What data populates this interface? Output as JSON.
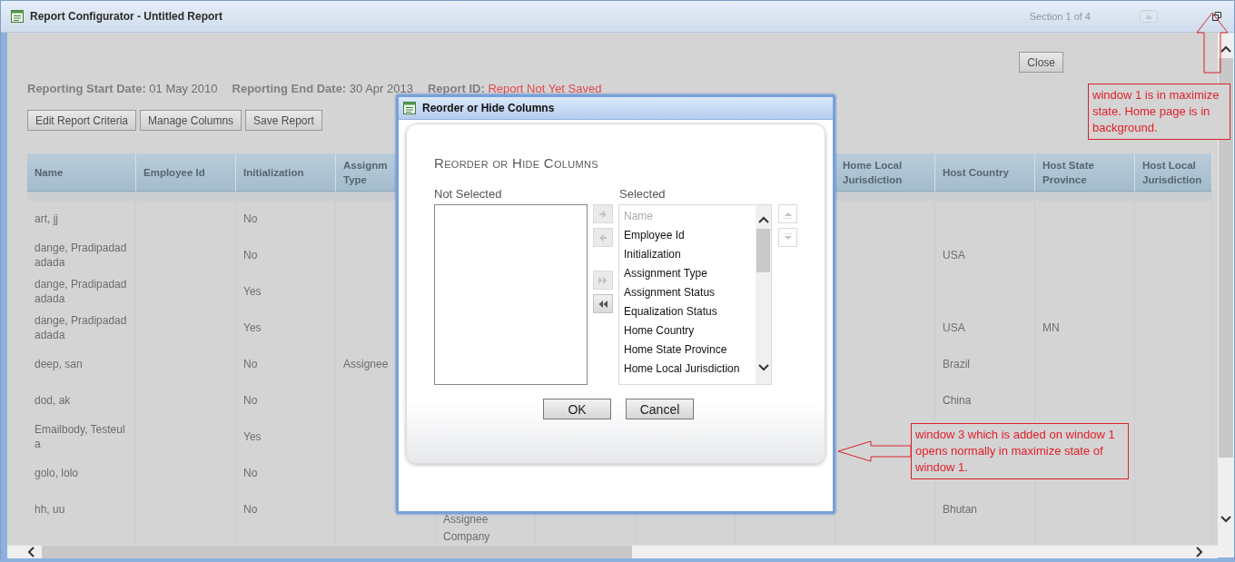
{
  "window": {
    "title": "Report Configurator - Untitled Report",
    "section_label": "Section 1 of 4"
  },
  "close_button": "Close",
  "report_info": [
    {
      "label": "Reporting Start Date:",
      "value": "01 May 2010",
      "kind": "plain"
    },
    {
      "label": "Reporting End Date:",
      "value": "30 Apr 2013",
      "kind": "plain"
    },
    {
      "label": "Report ID:",
      "value": "Report Not Yet Saved",
      "kind": "alert"
    }
  ],
  "toolbar": [
    "Edit Report Criteria",
    "Manage Columns",
    "Save Report"
  ],
  "table": {
    "columns": [
      "Name",
      "Employee Id",
      "Initialization",
      "Assignm Type",
      null,
      null,
      null,
      null,
      "Home Local Jurisdiction",
      "Host Country",
      "Host State Province",
      "Host Local Jurisdiction"
    ],
    "rows": [
      [
        "art, jj",
        null,
        "No",
        null,
        null,
        null,
        null,
        null,
        null,
        null,
        null,
        null
      ],
      [
        "dange, Pradipadadadada",
        null,
        "No",
        null,
        null,
        null,
        null,
        null,
        null,
        "USA",
        null,
        null
      ],
      [
        "dange, Pradipadadadada",
        null,
        "Yes",
        null,
        null,
        null,
        null,
        null,
        null,
        null,
        null,
        null
      ],
      [
        "dange, Pradipadadadada",
        null,
        "Yes",
        null,
        null,
        null,
        null,
        null,
        null,
        "USA",
        "MN",
        null
      ],
      [
        "deep, san",
        null,
        "No",
        "Assignee",
        null,
        null,
        null,
        null,
        null,
        "Brazil",
        null,
        null
      ],
      [
        "dod, ak",
        null,
        "No",
        null,
        null,
        null,
        null,
        null,
        null,
        "China",
        null,
        null
      ],
      [
        "Emailbody, Testeula",
        null,
        "Yes",
        null,
        null,
        null,
        null,
        null,
        null,
        null,
        null,
        null
      ],
      [
        "golo, lolo",
        null,
        "No",
        null,
        null,
        null,
        null,
        null,
        null,
        null,
        null,
        null
      ],
      [
        "hh, uu",
        null,
        "No",
        null,
        "Assignee",
        null,
        null,
        null,
        null,
        "Bhutan",
        null,
        null
      ],
      [
        null,
        null,
        null,
        null,
        "Company",
        null,
        null,
        null,
        null,
        null,
        null,
        null
      ]
    ]
  },
  "dialog": {
    "title": "Reorder or Hide Columns",
    "heading": "Reorder or Hide Columns",
    "not_selected_label": "Not Selected",
    "selected_label": "Selected",
    "selected_items": [
      {
        "text": "Name",
        "disabled": true
      },
      {
        "text": "Employee Id",
        "disabled": false
      },
      {
        "text": "Initialization",
        "disabled": false
      },
      {
        "text": "Assignment Type",
        "disabled": false
      },
      {
        "text": "Assignment Status",
        "disabled": false
      },
      {
        "text": "Equalization Status",
        "disabled": false
      },
      {
        "text": "Home Country",
        "disabled": false
      },
      {
        "text": "Home State Province",
        "disabled": false
      },
      {
        "text": "Home Local Jurisdiction",
        "disabled": false
      }
    ],
    "move_buttons": [
      {
        "kind": "move-right",
        "disabled": true
      },
      {
        "kind": "move-left",
        "disabled": true
      },
      {
        "kind": "move-all-right",
        "disabled": true
      },
      {
        "kind": "move-all-left",
        "disabled": false
      }
    ],
    "order_buttons": [
      {
        "kind": "move-up",
        "disabled": true
      },
      {
        "kind": "move-down",
        "disabled": true
      }
    ],
    "buttons": [
      "OK",
      "Cancel"
    ]
  },
  "annotations": [
    {
      "kind": "arrow-up",
      "text": "window 1 is in maximize state.  Home page is in background."
    },
    {
      "kind": "arrow-left",
      "text": "window 3 which is added on window 1 opens normally in maximize state of window 1."
    }
  ]
}
